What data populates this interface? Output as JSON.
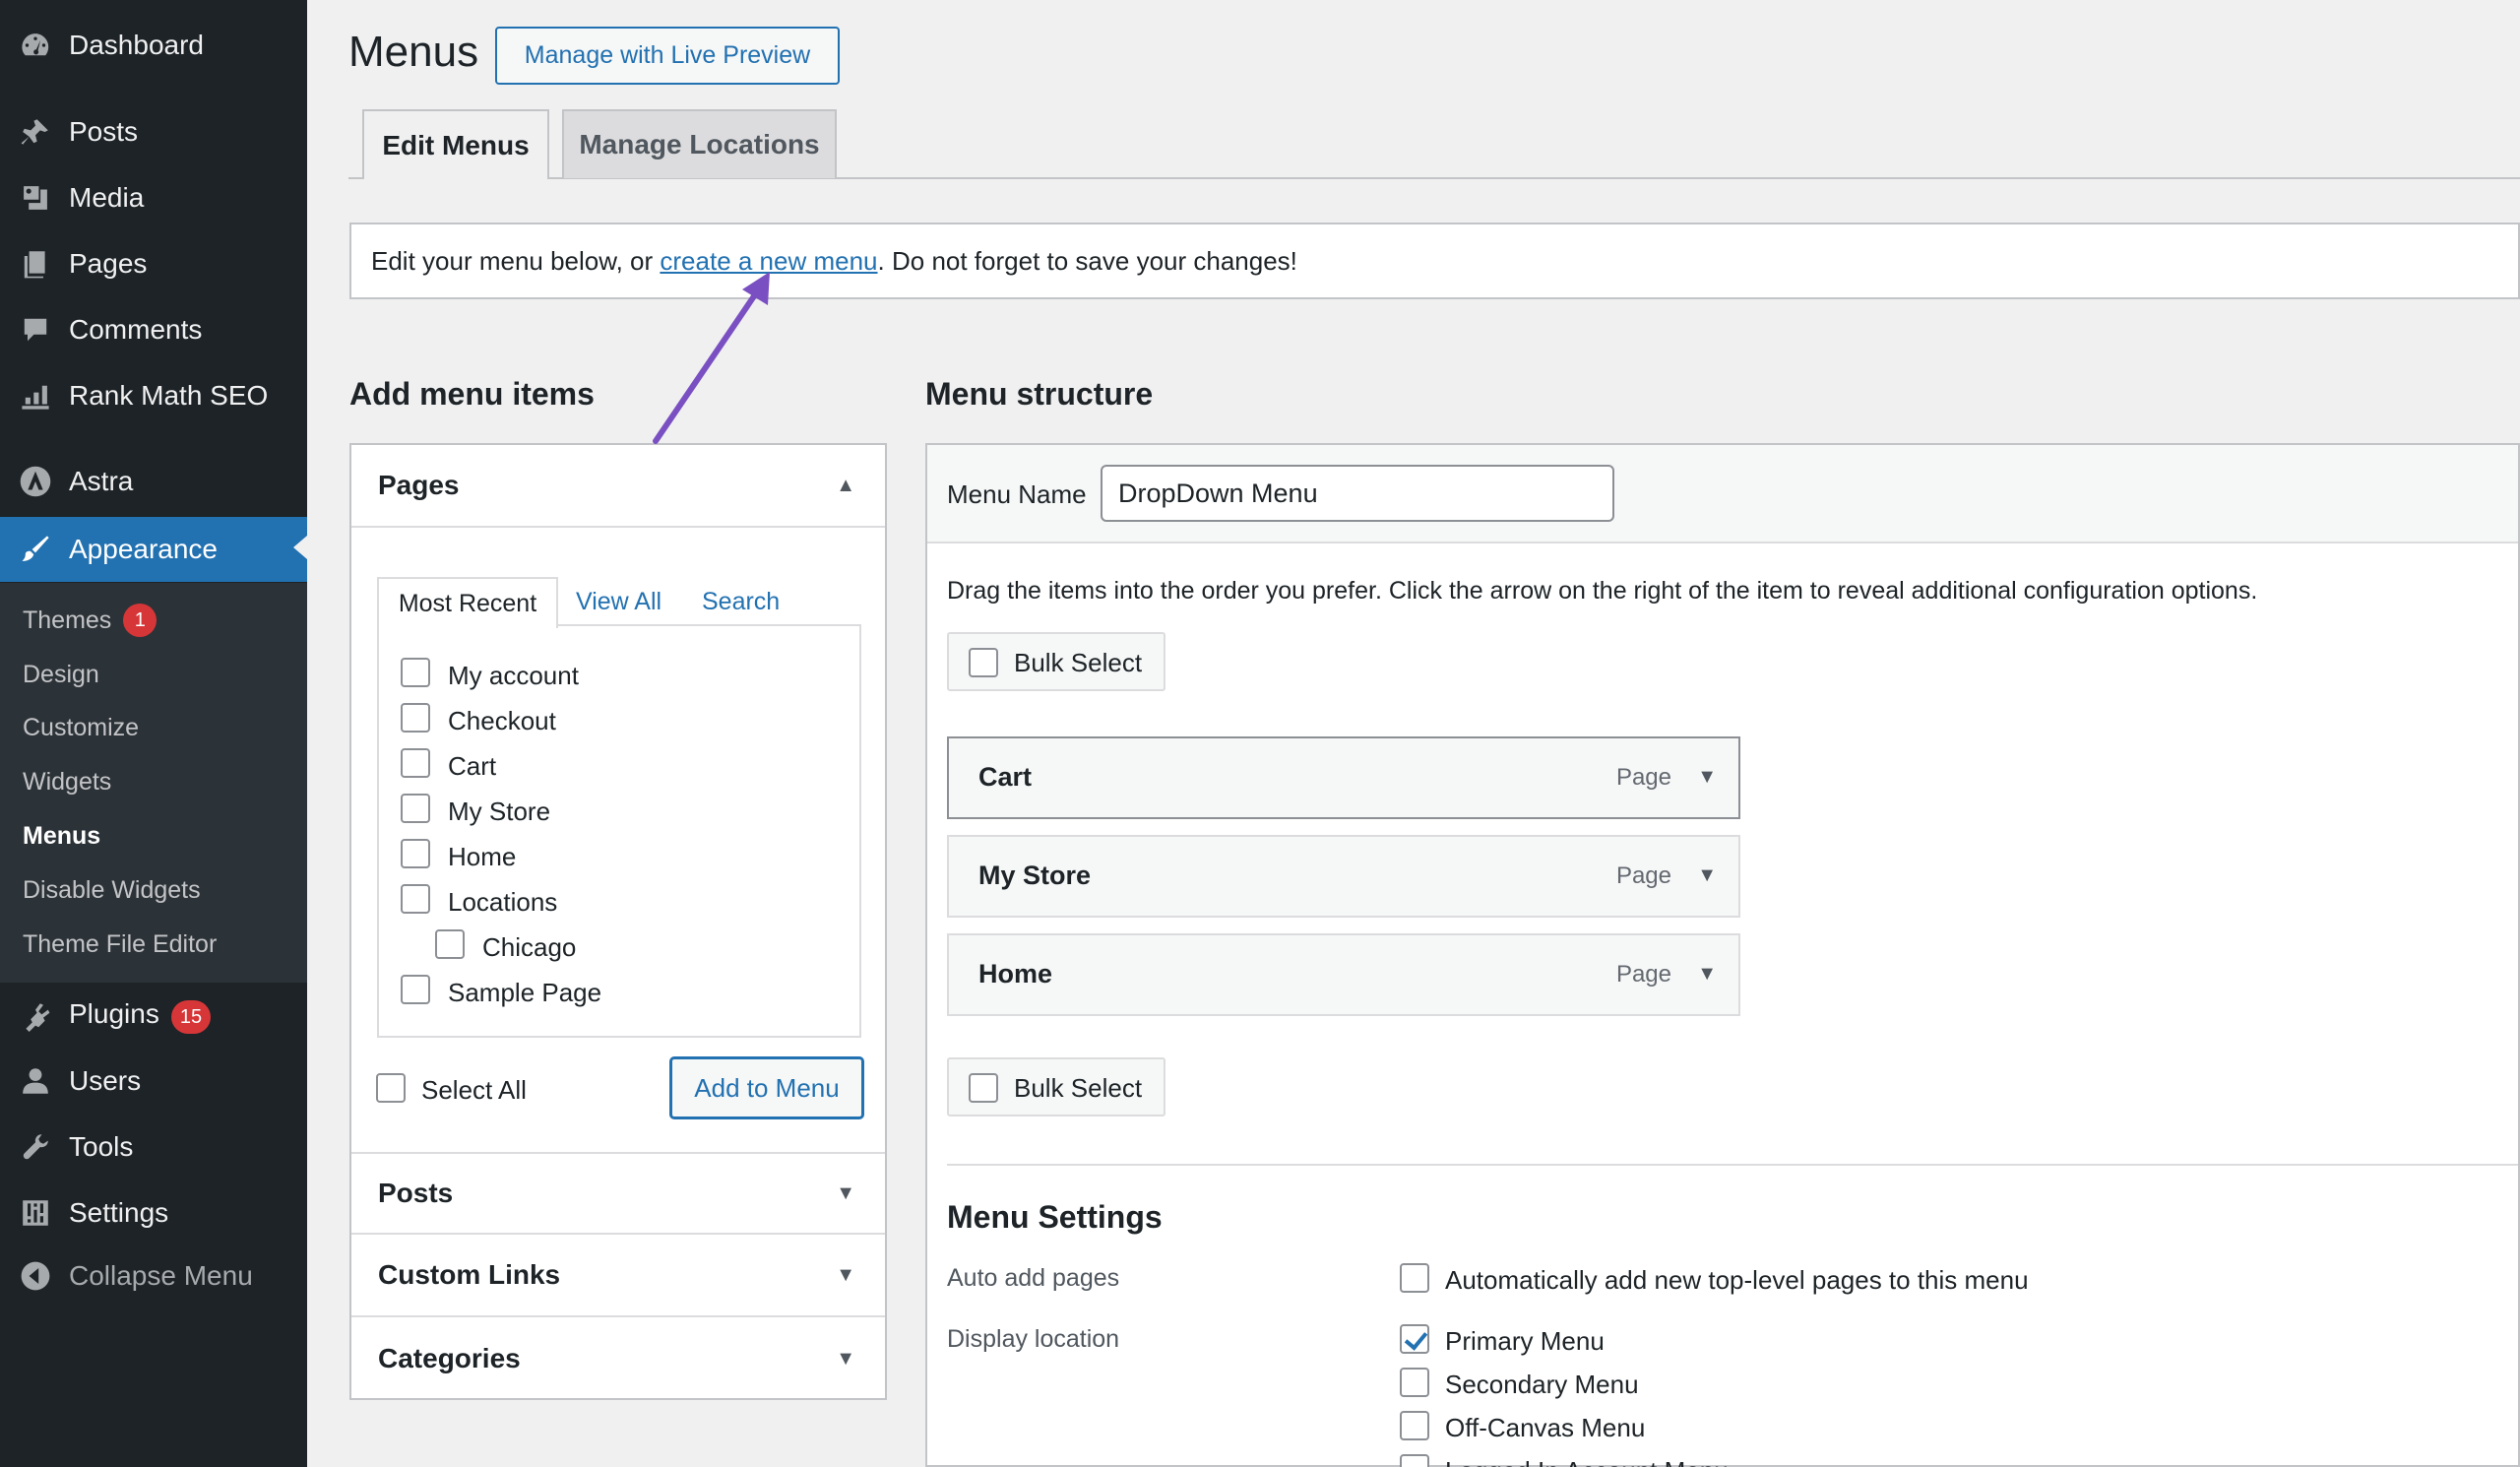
{
  "sidebar": {
    "items": [
      {
        "label": "Dashboard",
        "icon": "dashboard-icon"
      },
      {
        "label": "Posts",
        "icon": "pin-icon"
      },
      {
        "label": "Media",
        "icon": "media-icon"
      },
      {
        "label": "Pages",
        "icon": "pages-icon"
      },
      {
        "label": "Comments",
        "icon": "comment-icon"
      },
      {
        "label": "Rank Math SEO",
        "icon": "chart-icon"
      },
      {
        "label": "Astra",
        "icon": "astra-icon"
      },
      {
        "label": "Appearance",
        "icon": "brush-icon"
      },
      {
        "label": "Plugins",
        "icon": "plug-icon",
        "badge": "15"
      },
      {
        "label": "Users",
        "icon": "user-icon"
      },
      {
        "label": "Tools",
        "icon": "wrench-icon"
      },
      {
        "label": "Settings",
        "icon": "sliders-icon"
      },
      {
        "label": "Collapse Menu",
        "icon": "collapse-icon"
      }
    ],
    "submenu": [
      {
        "label": "Themes",
        "badge": "1"
      },
      {
        "label": "Design"
      },
      {
        "label": "Customize"
      },
      {
        "label": "Widgets"
      },
      {
        "label": "Menus"
      },
      {
        "label": "Disable Widgets"
      },
      {
        "label": "Theme File Editor"
      }
    ]
  },
  "header": {
    "title": "Menus",
    "live_preview_label": "Manage with Live Preview",
    "tabs": [
      {
        "label": "Edit Menus"
      },
      {
        "label": "Manage Locations"
      }
    ]
  },
  "notice": {
    "before": "Edit your menu below, or ",
    "link": "create a new menu",
    "after": ". Do not forget to save your changes!"
  },
  "add_items": {
    "heading": "Add menu items",
    "pages_title": "Pages",
    "inner_tabs": [
      "Most Recent",
      "View All",
      "Search"
    ],
    "pages": [
      "My account",
      "Checkout",
      "Cart",
      "My Store",
      "Home",
      "Locations",
      "Chicago",
      "Sample Page"
    ],
    "select_all_label": "Select All",
    "add_button_label": "Add to Menu",
    "sections": [
      "Posts",
      "Custom Links",
      "Categories"
    ]
  },
  "structure": {
    "heading": "Menu structure",
    "menu_name_label": "Menu Name",
    "menu_name_value": "DropDown Menu",
    "instructions": "Drag the items into the order you prefer. Click the arrow on the right of the item to reveal additional configuration options.",
    "bulk_select_label": "Bulk Select",
    "items": [
      {
        "title": "Cart",
        "type": "Page"
      },
      {
        "title": "My Store",
        "type": "Page"
      },
      {
        "title": "Home",
        "type": "Page"
      }
    ]
  },
  "settings": {
    "heading": "Menu Settings",
    "auto_add_label": "Auto add pages",
    "auto_add_option": "Automatically add new top-level pages to this menu",
    "display_location_label": "Display location",
    "locations": [
      {
        "label": "Primary Menu",
        "checked": true
      },
      {
        "label": "Secondary Menu",
        "checked": false
      },
      {
        "label": "Off-Canvas Menu",
        "checked": false
      },
      {
        "label": "Logged In Account Menu",
        "checked": false
      }
    ]
  },
  "colors": {
    "accent": "#2271b1",
    "sidebar_bg": "#1d2327",
    "active": "#2271b1",
    "badge": "#d63638",
    "annotation_arrow": "#7a4fc2"
  }
}
